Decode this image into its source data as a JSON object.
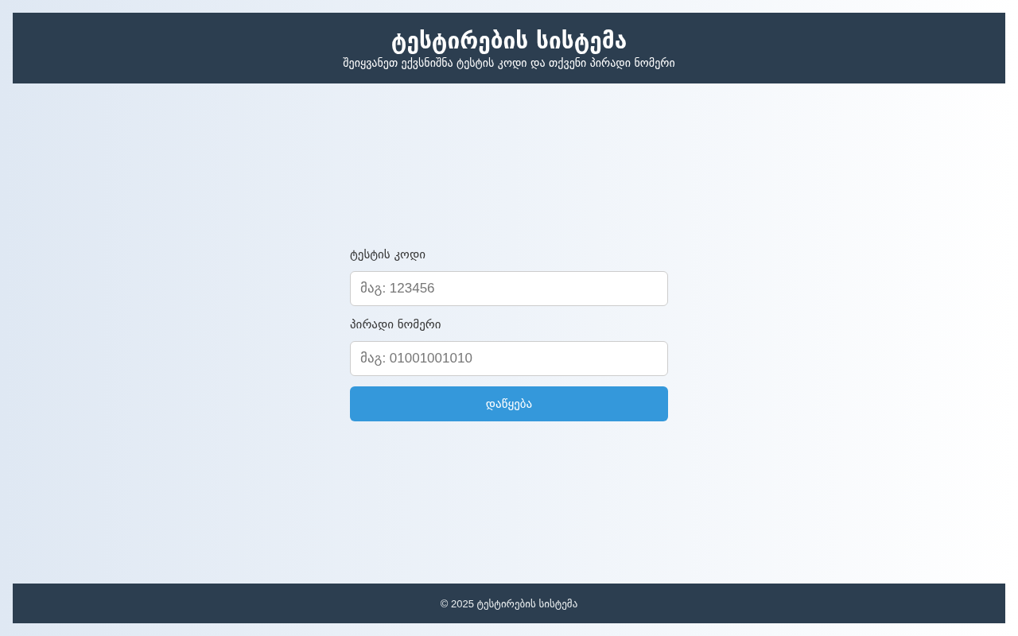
{
  "header": {
    "title": "ტესტირების სისტემა",
    "subtitle": "შეიყვანეთ ექვსნიშნა ტესტის კოდი და თქვენი პირადი ნომერი"
  },
  "form": {
    "fields": [
      {
        "label": "ტესტის კოდი",
        "placeholder": "მაგ: 123456"
      },
      {
        "label": "პირადი ნომერი",
        "placeholder": "მაგ: 01001001010"
      }
    ],
    "submit_button": "დაწყება"
  },
  "footer": {
    "text": "© 2025 ტესტირების სისტემა"
  }
}
